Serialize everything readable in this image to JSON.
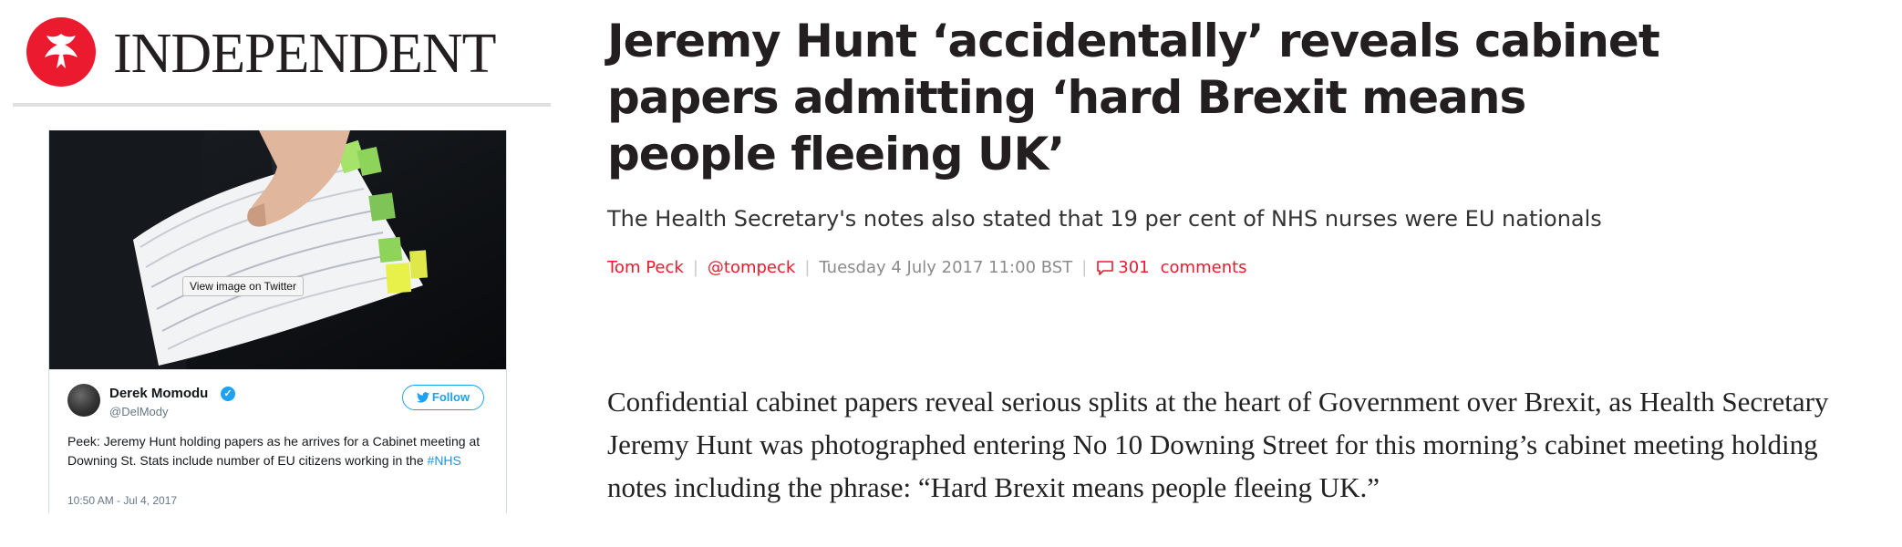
{
  "masthead": {
    "brand": "INDEPENDENT",
    "logo_icon": "eagle-icon",
    "accent_color": "#ec1a2e"
  },
  "tweet": {
    "image_button": "View image on Twitter",
    "author_name": "Derek Momodu",
    "author_handle": "@DelMody",
    "verified_icon": "verified-badge-icon",
    "follow_label": "Follow",
    "text": "Peek: Jeremy Hunt holding papers as he arrives for a Cabinet meeting at Downing St. Stats include number of EU citizens working in the ",
    "hashtag": "#NHS",
    "timestamp": "10:50 AM - Jul 4, 2017",
    "link_color": "#1b95e0"
  },
  "article": {
    "headline": "Jeremy Hunt ‘accidentally’ reveals cabinet papers admitting ‘hard Brexit means people fleeing UK’",
    "standfirst": "The Health Secretary's notes also stated that 19 per cent of NHS nurses were EU nationals",
    "byline": {
      "author": "Tom Peck",
      "twitter": "@tompeck",
      "date": "Tuesday 4 July 2017 11:00 BST",
      "comment_count": "301",
      "comments_label": "comments"
    },
    "body": "Confidential cabinet papers reveal serious splits at the heart of Government over Brexit, as Health Secretary Jeremy Hunt was photographed entering No 10 Downing Street for this morning’s cabinet meeting holding notes including the phrase: “Hard Brexit means people fleeing UK.”"
  }
}
